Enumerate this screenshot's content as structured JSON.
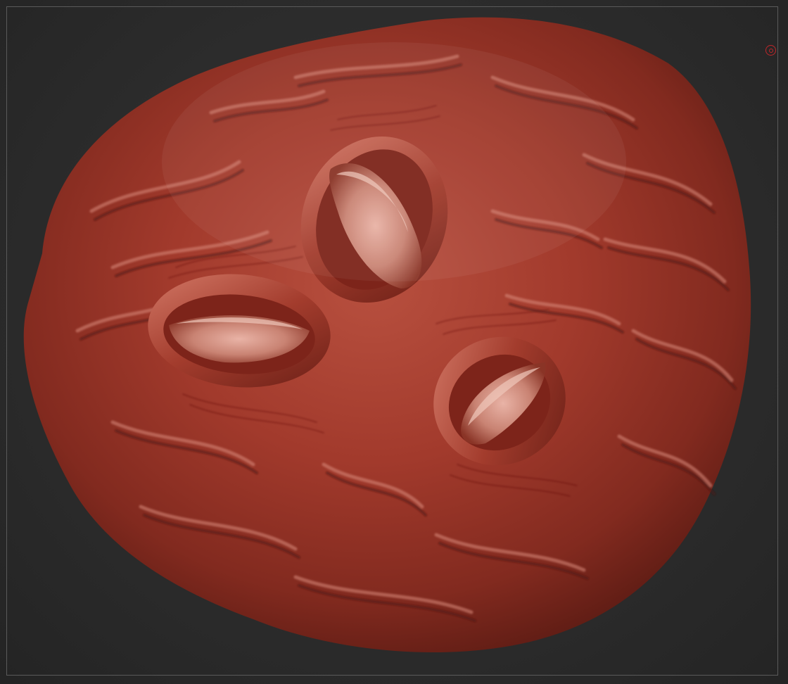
{
  "app": {
    "window_title": ""
  },
  "viewport": {
    "background_color": "#2a2a2a",
    "frame_color": "#5a5a5a"
  },
  "model": {
    "material_color": "#a23a2c",
    "highlight_color": "#d98a7c",
    "shadow_color": "#4a120c",
    "features": [
      "upper-eye-slit",
      "left-eye-slit",
      "right-eye-slit"
    ]
  },
  "indicator": {
    "icon": "perspective-circle-icon",
    "color": "#c0272a"
  }
}
